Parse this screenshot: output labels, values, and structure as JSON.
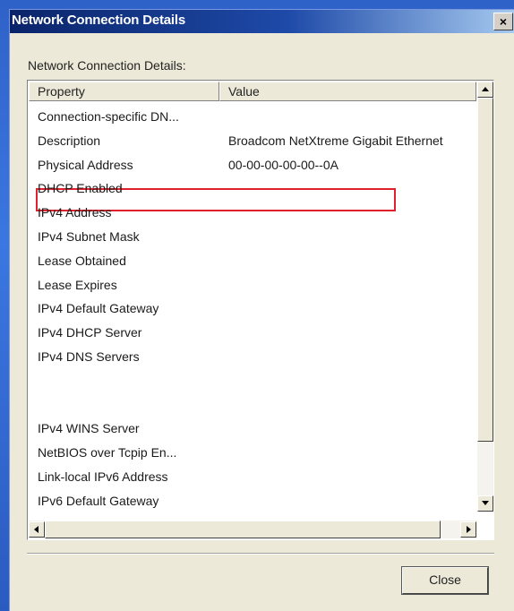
{
  "window": {
    "title": "Network Connection Details",
    "close_glyph": "×"
  },
  "section_label": "Network Connection Details:",
  "columns": [
    "Property",
    "Value"
  ],
  "rows": [
    {
      "property": "Connection-specific DN...",
      "value": ""
    },
    {
      "property": "Description",
      "value": "Broadcom NetXtreme Gigabit Ethernet"
    },
    {
      "property": "Physical Address",
      "value": "00-00-00-00-00--0A"
    },
    {
      "property": "DHCP Enabled",
      "value": ""
    },
    {
      "property": "IPv4 Address",
      "value": ""
    },
    {
      "property": "IPv4 Subnet Mask",
      "value": ""
    },
    {
      "property": "Lease Obtained",
      "value": ""
    },
    {
      "property": "Lease Expires",
      "value": ""
    },
    {
      "property": "IPv4 Default Gateway",
      "value": ""
    },
    {
      "property": "IPv4 DHCP Server",
      "value": ""
    },
    {
      "property": "IPv4 DNS Servers",
      "value": ""
    },
    {
      "property": "",
      "value": ""
    },
    {
      "property": "",
      "value": ""
    },
    {
      "property": "IPv4 WINS Server",
      "value": ""
    },
    {
      "property": "NetBIOS over Tcpip En...",
      "value": ""
    },
    {
      "property": "Link-local IPv6 Address",
      "value": ""
    },
    {
      "property": "IPv6 Default Gateway",
      "value": ""
    }
  ],
  "highlighted_row": "Physical Address",
  "colors": {
    "highlight": "#e0202a",
    "title_bar": "#0a246a"
  },
  "buttons": {
    "close": "Close"
  }
}
